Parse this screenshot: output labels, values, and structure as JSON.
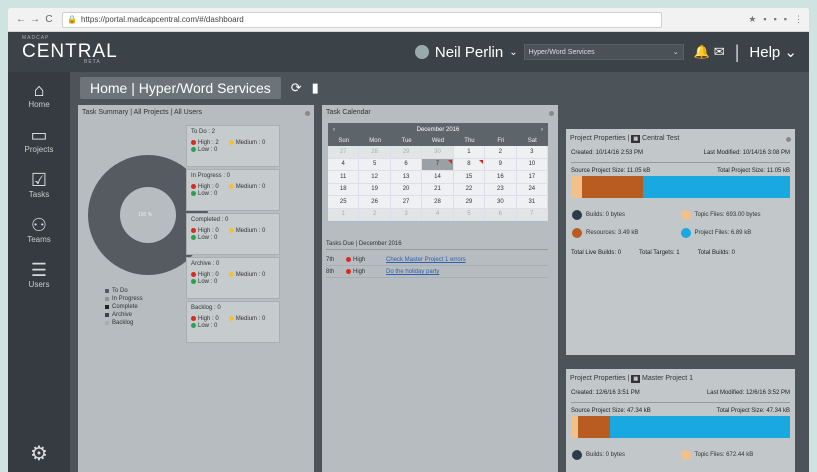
{
  "browser": {
    "url": "https://portal.madcapcentral.com/#/dashboard"
  },
  "app": {
    "logo_top": "MADCAP",
    "logo": "CENTRAL",
    "logo_sub": "BETA"
  },
  "header": {
    "user": "Neil Perlin",
    "project_select": "Hyper/Word Services",
    "help": "Help"
  },
  "sidebar": {
    "items": [
      {
        "label": "Home",
        "icon": "home-icon"
      },
      {
        "label": "Projects",
        "icon": "folder-icon"
      },
      {
        "label": "Tasks",
        "icon": "tasks-icon"
      },
      {
        "label": "Teams",
        "icon": "teams-icon"
      },
      {
        "label": "Users",
        "icon": "users-icon"
      }
    ]
  },
  "page": {
    "title": "Home | Hyper/Word Services"
  },
  "summary": {
    "title": "Task Summary | All Projects | All Users",
    "center": "100 %",
    "legend": [
      "To Do",
      "In Progress",
      "Complete",
      "Archive",
      "Backlog"
    ],
    "legend_colors": [
      "#555b60",
      "#8d9498",
      "#1f2326",
      "#3c4348",
      "#a8aeb2"
    ],
    "stats": [
      {
        "title": "To Do : 2",
        "high": "High : 2",
        "low": "Low : 0",
        "medium": "Medium : 0"
      },
      {
        "title": "In Progress : 0",
        "high": "High : 0",
        "low": "Low : 0",
        "medium": "Medium : 0"
      },
      {
        "title": "Completed : 0",
        "high": "High : 0",
        "low": "Low : 0",
        "medium": "Medium : 0"
      },
      {
        "title": "Archive : 0",
        "high": "High : 0",
        "low": "Low : 0",
        "medium": "Medium : 0"
      },
      {
        "title": "Backlog : 0",
        "high": "High : 0",
        "low": "Low : 0",
        "medium": "Medium : 0"
      }
    ]
  },
  "calendar": {
    "title": "Task Calendar",
    "month": "December 2016",
    "dow": [
      "Sun",
      "Mon",
      "Tue",
      "Wed",
      "Thu",
      "Fri",
      "Sat"
    ],
    "cells": [
      {
        "d": "27",
        "o": true
      },
      {
        "d": "28",
        "o": true
      },
      {
        "d": "29",
        "o": true
      },
      {
        "d": "30",
        "o": true
      },
      {
        "d": "1"
      },
      {
        "d": "2"
      },
      {
        "d": "3"
      },
      {
        "d": "4"
      },
      {
        "d": "5"
      },
      {
        "d": "6"
      },
      {
        "d": "7",
        "t": true,
        "f": true
      },
      {
        "d": "8",
        "f": true
      },
      {
        "d": "9"
      },
      {
        "d": "10"
      },
      {
        "d": "11"
      },
      {
        "d": "12"
      },
      {
        "d": "13"
      },
      {
        "d": "14"
      },
      {
        "d": "15"
      },
      {
        "d": "16"
      },
      {
        "d": "17"
      },
      {
        "d": "18"
      },
      {
        "d": "19"
      },
      {
        "d": "20"
      },
      {
        "d": "21"
      },
      {
        "d": "22"
      },
      {
        "d": "23"
      },
      {
        "d": "24"
      },
      {
        "d": "25"
      },
      {
        "d": "26"
      },
      {
        "d": "27"
      },
      {
        "d": "28"
      },
      {
        "d": "29"
      },
      {
        "d": "30"
      },
      {
        "d": "31"
      },
      {
        "d": "1",
        "o": true
      },
      {
        "d": "2",
        "o": true
      },
      {
        "d": "3",
        "o": true
      },
      {
        "d": "4",
        "o": true
      },
      {
        "d": "5",
        "o": true
      },
      {
        "d": "6",
        "o": true
      },
      {
        "d": "7",
        "o": true
      }
    ],
    "due_title": "Tasks Due | December 2016",
    "due": [
      {
        "day": "7th",
        "priority": "High",
        "task": "Check Master Project 1 errors"
      },
      {
        "day": "8th",
        "priority": "High",
        "task": "Do the holiday party"
      }
    ]
  },
  "props1": {
    "title": "Project Properties |",
    "project": "Central Test",
    "created": "Created: 10/14/16 2:53 PM",
    "modified": "Last Modified: 10/14/16 3:08 PM",
    "source": "Source Project Size: 11.05 kB",
    "total": "Total Project Size: 11.05 kB",
    "segments": [
      0.05,
      0.28,
      0.67
    ],
    "builds": "Builds: 0 bytes",
    "topic": "Topic Files: 693.00 bytes",
    "resources": "Resources: 3.49 kB",
    "pfiles": "Project Files: 6.89 kB",
    "live": "Total Live Builds: 0",
    "targets": "Total Targets: 1",
    "tbuilds": "Total Builds: 0"
  },
  "props2": {
    "title": "Project Properties |",
    "project": "Master Project 1",
    "created": "Created: 12/6/16 3:51 PM",
    "modified": "Last Modified: 12/6/16 3:52 PM",
    "source": "Source Project Size: 47.34 kB",
    "total": "Total Project Size: 47.34 kB",
    "segments": [
      0.03,
      0.15,
      0.82
    ],
    "builds": "Builds: 0 bytes",
    "topic": "Topic Files: 672.44 kB"
  },
  "colors": {
    "builds": "#2d3a4a",
    "topic": "#f3c08a",
    "resources": "#b85c22",
    "pfiles": "#1aa8e0"
  }
}
